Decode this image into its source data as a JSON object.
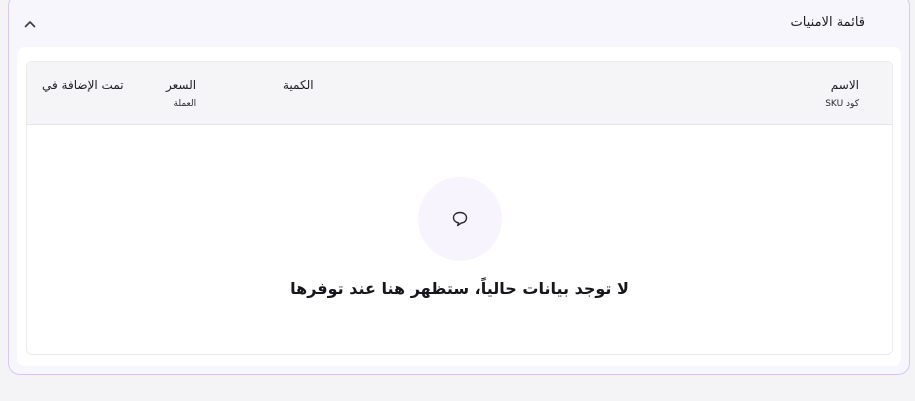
{
  "wishlist": {
    "title": "قائمة الامنيات",
    "collapse_icon": "chevron-up-icon",
    "columns": [
      {
        "label": "الاسم",
        "sublabel": "كود SKU"
      },
      {
        "label": "الكمية",
        "sublabel": ""
      },
      {
        "label": "السعر",
        "sublabel": "العملة"
      },
      {
        "label": "تمت الإضافة في",
        "sublabel": ""
      }
    ],
    "empty_state": {
      "icon": "message-bubble-icon",
      "message": "لا توجد بيانات حالياً، ستظهر هنا عند توفرها"
    }
  }
}
